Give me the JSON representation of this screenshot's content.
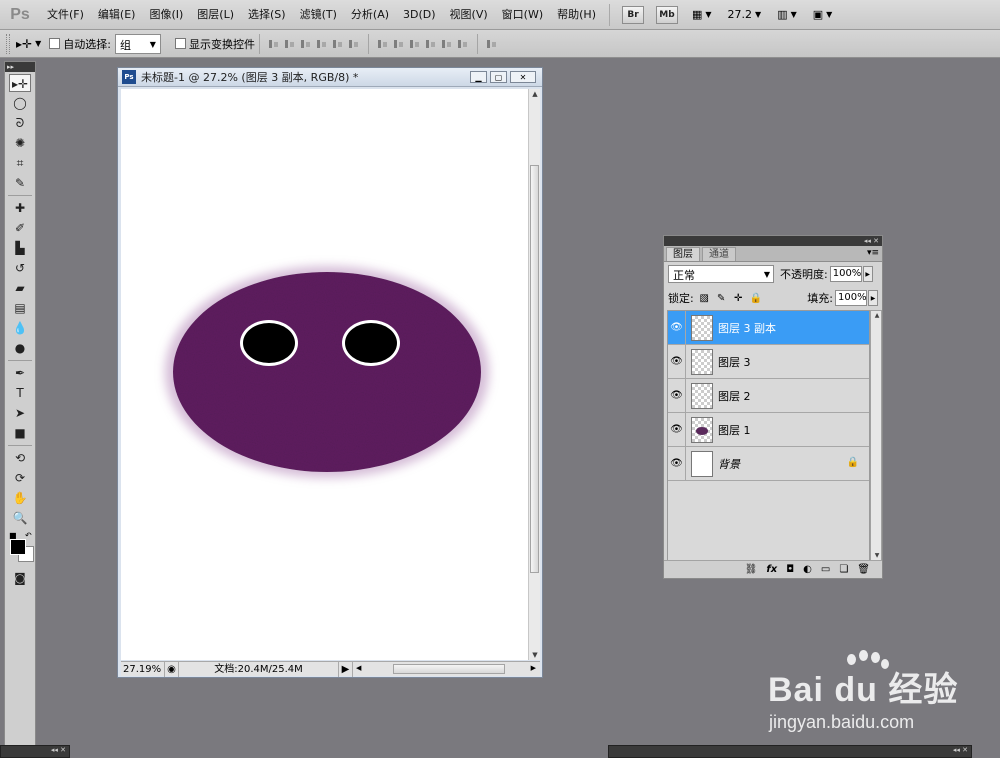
{
  "app": {
    "logo_text": "Ps"
  },
  "menu": {
    "items": [
      "文件(F)",
      "编辑(E)",
      "图像(I)",
      "图层(L)",
      "选择(S)",
      "滤镜(T)",
      "分析(A)",
      "3D(D)",
      "视图(V)",
      "窗口(W)",
      "帮助(H)"
    ],
    "bridge_label": "Br",
    "minibridge_label": "Mb",
    "zoom_value": "27.2"
  },
  "options": {
    "auto_select_label": "自动选择:",
    "auto_select_value": "组",
    "show_transform_label": "显示变换控件"
  },
  "document": {
    "title": "未标题-1 @ 27.2% (图层 3 副本, RGB/8) *",
    "zoom_readout": "27.19%",
    "doc_info": "文档:20.4M/25.4M"
  },
  "layers_panel": {
    "tabs": [
      "图层",
      "通道"
    ],
    "blend_mode": "正常",
    "opacity_label": "不透明度:",
    "opacity_value": "100%",
    "lock_label": "锁定:",
    "fill_label": "填充:",
    "fill_value": "100%",
    "layers": [
      {
        "name": "图层 3 副本",
        "selected": true
      },
      {
        "name": "图层 3",
        "selected": false
      },
      {
        "name": "图层 2",
        "selected": false
      },
      {
        "name": "图层 1",
        "selected": false
      },
      {
        "name": "背景",
        "selected": false
      }
    ]
  },
  "colors": {
    "face": "#5f1d60",
    "selection": "#3a9cf5",
    "canvas_bg": "#ffffff",
    "workspace": "#7a797e"
  },
  "watermark": {
    "brand": "Bai du 经验",
    "url": "jingyan.baidu.com"
  }
}
